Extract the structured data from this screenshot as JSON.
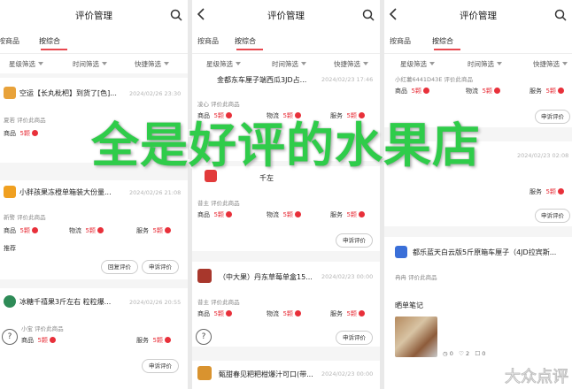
{
  "overlay_text": "全是好评的水果店",
  "watermark_text": "大众点评",
  "colors": {
    "accent": "#e8484f",
    "overlay_green": "#2fcc4a",
    "star_red": "#e8303a"
  },
  "header": {
    "title": "评价管理"
  },
  "tabs": {
    "item1": "按商品",
    "item1_cut": "按商品",
    "item2": "按综合"
  },
  "filters": {
    "star": "星级筛选",
    "time": "时间筛选",
    "quick": "快捷筛选"
  },
  "score_labels": {
    "goods": "商品",
    "logistics": "物流",
    "service": "服务",
    "five": "5颗"
  },
  "review_tag": "评价此商品",
  "buttons": {
    "reply": "回复评价",
    "appeal": "申诉评价"
  },
  "phone1": {
    "items": [
      {
        "name": "空运【长丸枇杷】到货了[色]...",
        "date": "2024/02/26 23:30",
        "user": "夏若"
      },
      {
        "name": "小胖孩果冻橙单箱装大份量...",
        "date": "2024/02/26 21:08",
        "user": "新警",
        "extra": "推荐"
      },
      {
        "name": "冰糖千禧果3斤左右 粒粒爆...",
        "date": "2024/02/26 20:55",
        "user": "小宝"
      }
    ]
  },
  "phone2": {
    "items": [
      {
        "name": "金都东车厘子端西瓜3JD占...",
        "date": "2024/02/23 17:46",
        "user": "凌心"
      },
      {
        "name": "千左",
        "date": "",
        "user": "昔主"
      },
      {
        "name": "（中大果）丹东草莓单盒15...",
        "date": "2024/02/23 00:00",
        "user": "昔主"
      },
      {
        "name": "甄甜春见粑粑柑爆汁可口(带...",
        "date": "2024/02/23 00:00",
        "user": ""
      }
    ]
  },
  "phone3": {
    "items": [
      {
        "name": "",
        "date": "",
        "user": "小红薯6441D43E"
      },
      {
        "name": "",
        "date": "2024/02/23 02:08",
        "user": ""
      },
      {
        "name": "都乐蓝天白云版5斤原箱车厘子（4JD拉宾斯...",
        "date": "",
        "user": "冉冉"
      }
    ],
    "notes_title": "晒单笔记",
    "stats": {
      "views": "0",
      "likes": "2",
      "comments": "0"
    }
  }
}
